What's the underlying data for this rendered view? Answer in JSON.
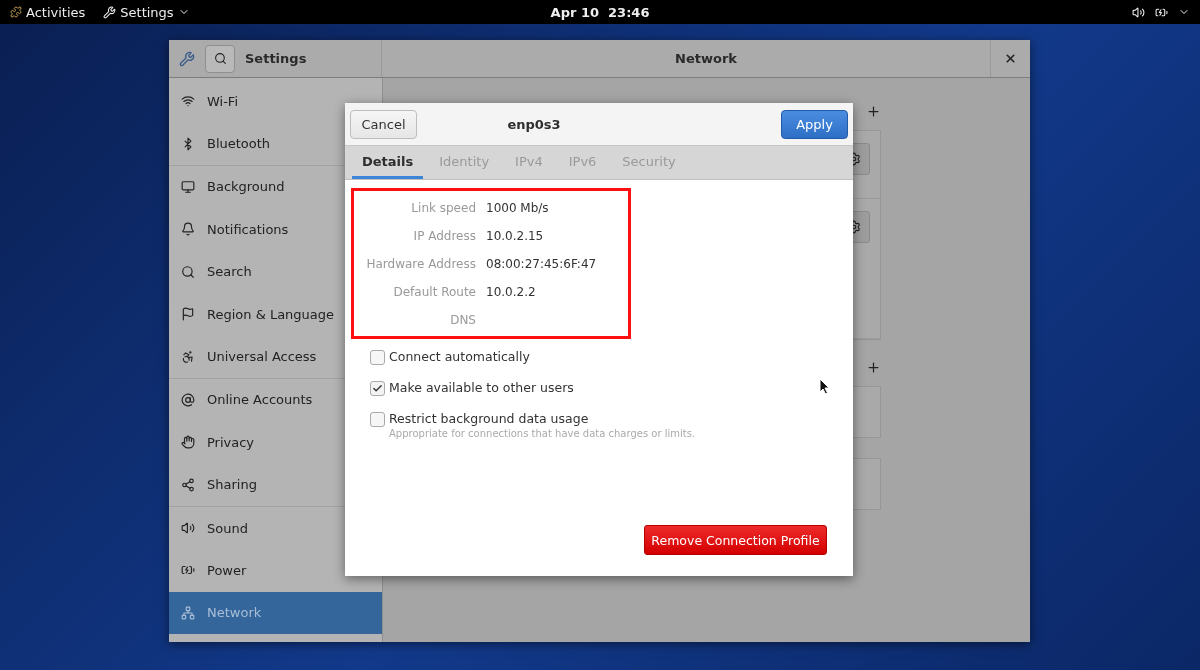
{
  "top_bar": {
    "activities": "Activities",
    "app_menu": "Settings",
    "clock": "Apr 10  23:46"
  },
  "settings_window": {
    "sidebar_title": "Settings",
    "title": "Network",
    "sidebar": {
      "groups": [
        {
          "items": [
            {
              "label": "Wi-Fi",
              "selected": false
            },
            {
              "label": "Bluetooth",
              "selected": false
            }
          ]
        },
        {
          "items": [
            {
              "label": "Background",
              "selected": false
            },
            {
              "label": "Notifications",
              "selected": false
            },
            {
              "label": "Search",
              "selected": false
            },
            {
              "label": "Region & Language",
              "selected": false
            },
            {
              "label": "Universal Access",
              "selected": false
            }
          ]
        },
        {
          "items": [
            {
              "label": "Online Accounts",
              "selected": false
            },
            {
              "label": "Privacy",
              "selected": false
            },
            {
              "label": "Sharing",
              "selected": false
            }
          ]
        },
        {
          "items": [
            {
              "label": "Sound",
              "selected": false
            },
            {
              "label": "Power",
              "selected": false
            },
            {
              "label": "Network",
              "selected": true
            }
          ]
        }
      ]
    }
  },
  "dialog": {
    "cancel": "Cancel",
    "title": "enp0s3",
    "apply": "Apply",
    "tabs": [
      {
        "label": "Details",
        "selected": true
      },
      {
        "label": "Identity",
        "selected": false
      },
      {
        "label": "IPv4",
        "selected": false
      },
      {
        "label": "IPv6",
        "selected": false
      },
      {
        "label": "Security",
        "selected": false
      }
    ],
    "details": [
      {
        "label": "Link speed",
        "value": "1000 Mb/s"
      },
      {
        "label": "IP Address",
        "value": "10.0.2.15"
      },
      {
        "label": "Hardware Address",
        "value": "08:00:27:45:6F:47"
      },
      {
        "label": "Default Route",
        "value": "10.0.2.2"
      },
      {
        "label": "DNS"
      }
    ],
    "options": [
      {
        "label": "Connect automatically",
        "checked": false
      },
      {
        "label": "Make available to other users",
        "checked": true
      },
      {
        "label": "Restrict background data usage",
        "checked": false,
        "description": "Appropriate for connections that have data charges or limits."
      }
    ],
    "remove_button": "Remove Connection Profile"
  }
}
